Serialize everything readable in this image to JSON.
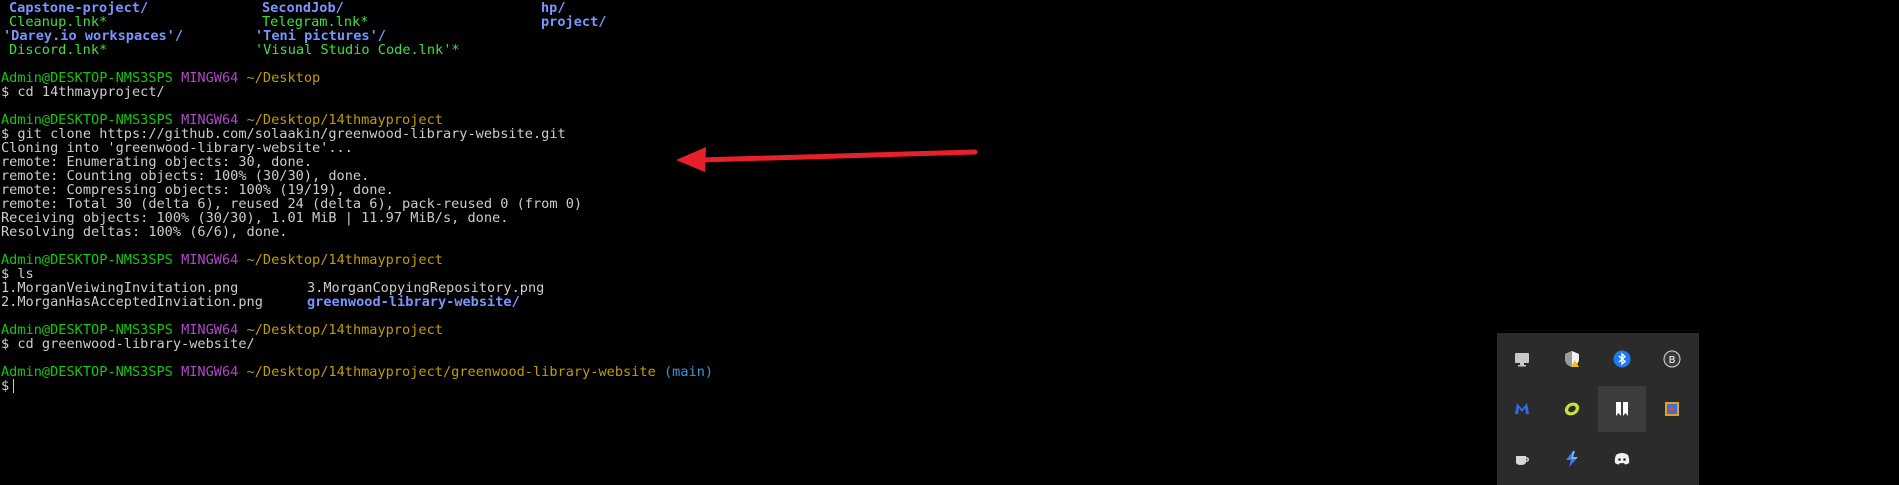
{
  "terminal": {
    "listing_top": {
      "col1": [
        "Capstone-project/",
        "Cleanup.lnk*",
        "'Darey.io workspaces'/",
        "Discord.lnk*"
      ],
      "col2": [
        "SecondJob/",
        "Telegram.lnk*",
        "'Teni pictures'/",
        "'Visual Studio Code.lnk'*"
      ],
      "col3": [
        "hp/",
        "project/"
      ]
    },
    "prompt": {
      "user_host": "Admin@DESKTOP-NMS3SPS",
      "shell": "MINGW64"
    },
    "blocks": [
      {
        "path": "~/Desktop",
        "command": "$ cd 14thmayproject/"
      },
      {
        "path": "~/Desktop/14thmayproject",
        "command": "$ git clone https://github.com/solaakin/greenwood-library-website.git"
      },
      {
        "path": "~/Desktop/14thmayproject",
        "command": "$ ls"
      },
      {
        "path": "~/Desktop/14thmayproject",
        "command": "$ cd greenwood-library-website/"
      },
      {
        "path": "~/Desktop/14thmayproject/greenwood-library-website",
        "branch": "(main)",
        "command": "$"
      }
    ],
    "clone_output": [
      "Cloning into 'greenwood-library-website'...",
      "remote: Enumerating objects: 30, done.",
      "remote: Counting objects: 100% (30/30), done.",
      "remote: Compressing objects: 100% (19/19), done.",
      "remote: Total 30 (delta 6), reused 24 (delta 6), pack-reused 0 (from 0)",
      "Receiving objects: 100% (30/30), 1.01 MiB | 11.97 MiB/s, done.",
      "Resolving deltas: 100% (6/6), done."
    ],
    "ls_output": {
      "row1_a": "1.MorganVeiwingInvitation.png",
      "row1_b": "3.MorganCopyingRepository.png",
      "row2_a": "2.MorganHasAcceptedInviation.png",
      "row2_b": "greenwood-library-website/"
    }
  },
  "annotation": {
    "arrow_color": "#e8202a"
  },
  "tray": {
    "icons": [
      "display-icon",
      "security-shield-icon",
      "bluetooth-icon",
      "app-b-icon",
      "malwarebytes-icon",
      "lime-app-icon",
      "bookmark-app-icon",
      "color-app-icon",
      "coffee-cup-icon",
      "lightning-app-icon",
      "discord-icon"
    ]
  }
}
